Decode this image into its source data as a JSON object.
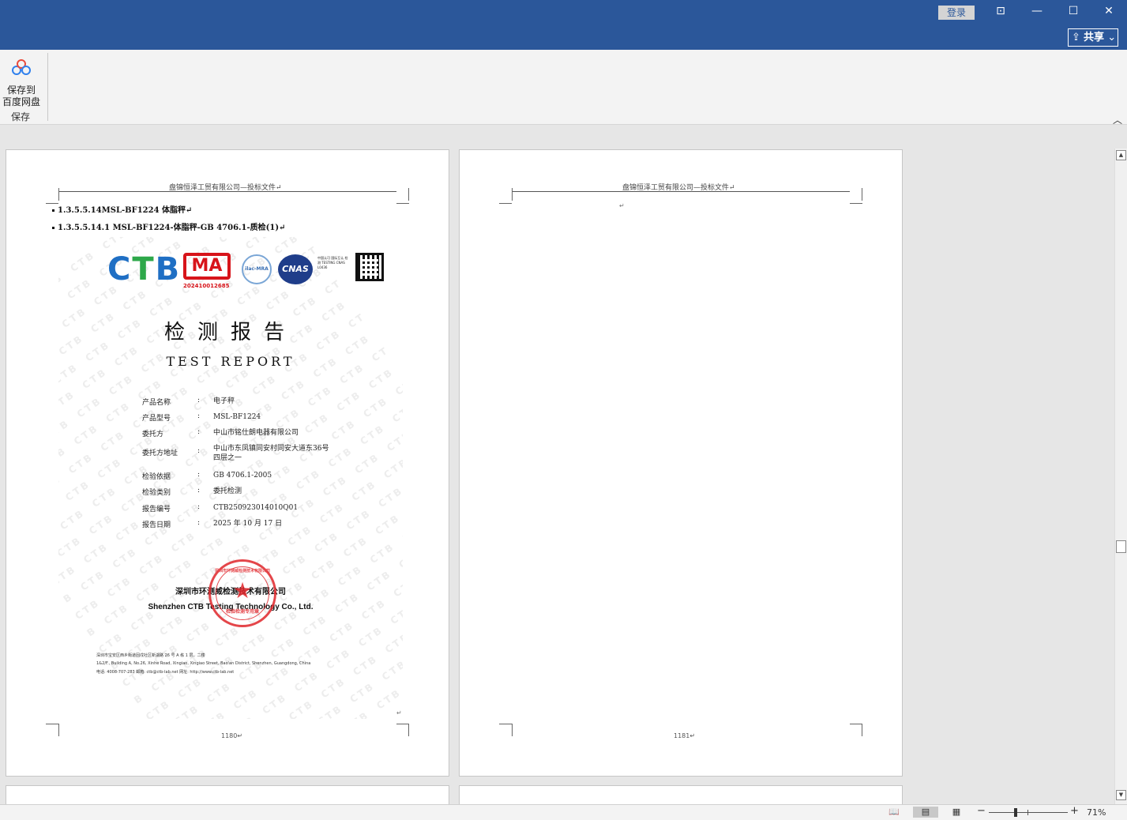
{
  "titlebar": {
    "login_label": "登录",
    "share_label": "共享",
    "restore_glyph": "⊡",
    "minimize_glyph": "—",
    "maximize_glyph": "☐",
    "close_glyph": "✕"
  },
  "ribbon": {
    "save_button_label_line1": "保存到",
    "save_button_label_line2": "百度网盘",
    "group_label": "保存",
    "collapse_glyph": "︿"
  },
  "pages": [
    {
      "header": "盘锦恒泽工贸有限公司—投标文件↵",
      "headings": [
        "1.3.5.5.14MSL-BF1224 体脂秤↵",
        "1.3.5.5.14.1  MSL-BF1224-体脂秤-GB 4706.1-质检(1)↵"
      ],
      "page_number": "1180↵",
      "para_mark": "↵"
    },
    {
      "header": "盘锦恒泽工贸有限公司—投标文件↵",
      "para_mark": "↵",
      "page_number": "1181↵"
    }
  ],
  "report": {
    "logo_ctb": "CTB",
    "logo_ma": "MA",
    "ma_number": "202410012685",
    "ilac_label": "ilac-MRA",
    "cnas_label": "CNAS",
    "cnas_text": "中国认可 国际互认 检测 TESTING CNAS L0436",
    "title_cn": "检测报告",
    "title_en": "TEST REPORT",
    "fields": [
      {
        "label": "产品名称",
        "value": "电子秤"
      },
      {
        "label": "产品型号",
        "value": "MSL-BF1224"
      },
      {
        "label": "委托方",
        "value": "中山市铭仕朗电器有限公司"
      },
      {
        "label": "委托方地址",
        "value": "中山市东凤镇同安村同安大道东36号四层之一"
      },
      {
        "label": "检验依据",
        "value": "GB 4706.1-2005"
      },
      {
        "label": "检验类别",
        "value": "委托检测"
      },
      {
        "label": "报告编号",
        "value": "CTB250923014010Q01"
      },
      {
        "label": "报告日期",
        "value": "2025 年 10 月 17 日"
      }
    ],
    "colon": ":",
    "company_cn": "深圳市环测威检测技术有限公司",
    "company_en": "Shenzhen CTB Testing Technology Co., Ltd.",
    "seal_top": "深圳市环测威检测技术有限公司",
    "seal_bottom": "检验检测专用章",
    "address_cn": "深圳市宝安区西乡街道固戍社区新湖路 26 号 A 栋 1 层、二楼",
    "address_en": "1&2/F., Building A, No.26, Xinhe Road, Xingiao, Xingiao Street, Bao'an District, Shenzhen, Guangdong, China",
    "contact": "电话: 4008-707-283      邮箱: ctb@ctb-lab.net      网址: http://www.ctb-lab.net",
    "watermark": "CTB"
  },
  "statusbar": {
    "zoom_minus": "−",
    "zoom_plus": "+",
    "zoom_level": "71%",
    "zoom_percent": 71,
    "read_mode_icon": "book-icon",
    "print_layout_icon": "print-layout-icon",
    "web_layout_icon": "web-layout-icon"
  },
  "colors": {
    "titlebar": "#2b579a",
    "ctb_c": "#1f6fc4",
    "ctb_t": "#2ea84a",
    "ctb_b": "#1f6fc4",
    "ma_red": "#d7141a",
    "seal_red": "#e0262b"
  }
}
